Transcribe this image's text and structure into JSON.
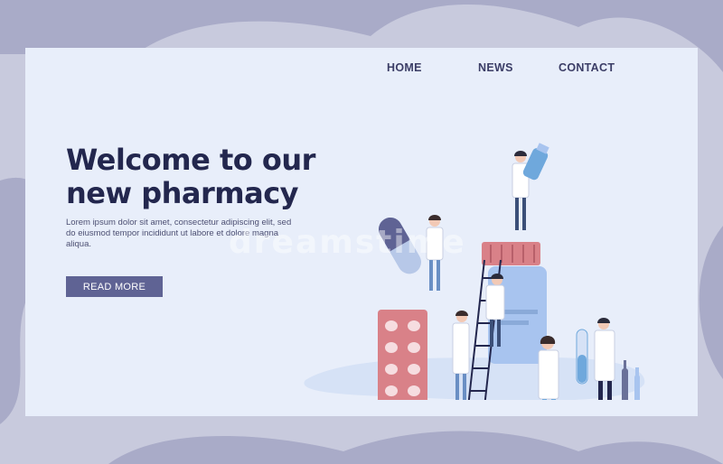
{
  "nav": {
    "home": "HOME",
    "news": "NEWS",
    "contact": "CONTACT"
  },
  "hero": {
    "title_line1": "Welcome to our",
    "title_line2": "new pharmacy",
    "description": "Lorem ipsum dolor sit amet, consectetur adipiscing elit, sed do eiusmod tempor incididunt ut labore et dolore magna aliqua.",
    "button_label": "READ MORE"
  },
  "watermark": "dreamstime",
  "colors": {
    "page_background": "#c8cadd",
    "card_background": "#e8eefa",
    "title": "#23274e",
    "button": "#5f6394",
    "pill_pack": "#d98188",
    "jar": "#a8c4ef"
  }
}
